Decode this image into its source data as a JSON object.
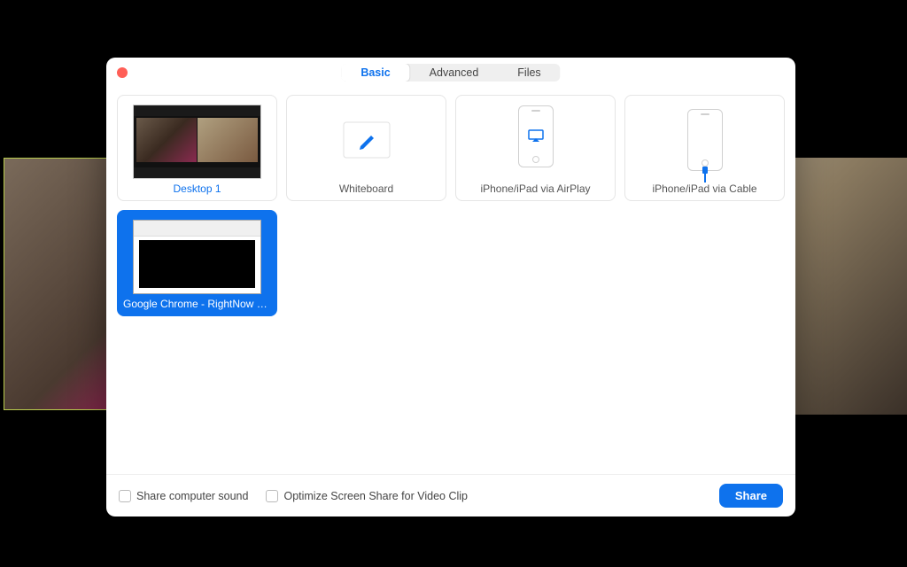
{
  "tabs": {
    "basic": "Basic",
    "advanced": "Advanced",
    "files": "Files"
  },
  "tiles": {
    "desktop": "Desktop 1",
    "whiteboard": "Whiteboard",
    "airplay": "iPhone/iPad via AirPlay",
    "cable": "iPhone/iPad via Cable",
    "chrome": "Google Chrome - RightNow Medi..."
  },
  "footer": {
    "sound": "Share computer sound",
    "optimize": "Optimize Screen Share for Video Clip",
    "share": "Share"
  },
  "colors": {
    "primary": "#0e72ed"
  }
}
